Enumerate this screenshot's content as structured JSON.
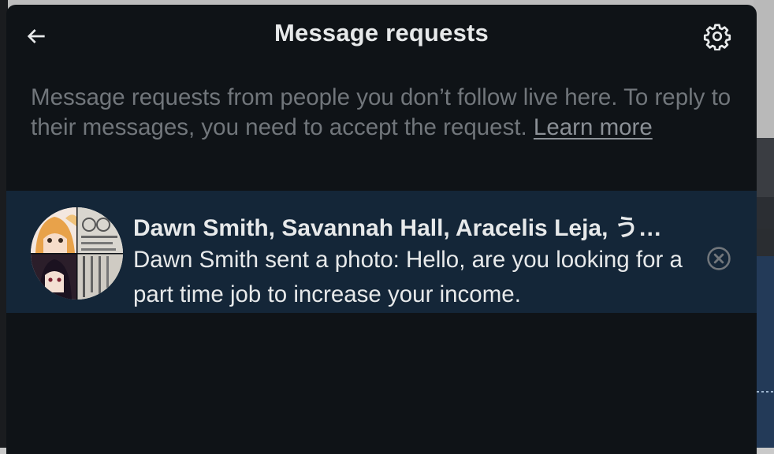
{
  "header": {
    "title": "Message requests",
    "back_icon": "arrow-left-icon",
    "settings_icon": "gear-icon"
  },
  "intro": {
    "text": "Message requests from people you don’t follow live here. To reply to their messages, you need to accept the request. ",
    "link": "Learn more"
  },
  "requests": [
    {
      "participants": "Dawn Smith, Savannah Hall, Aracelis Leja, う…",
      "preview": "Dawn Smith sent a photo: Hello, are you looking for a part time job to increase your income.",
      "dismiss_icon": "close-circle-icon"
    }
  ],
  "colors": {
    "panel_bg": "#0f1317",
    "row_bg": "#142638",
    "primary_text": "#e7e9ea",
    "secondary_text": "#71767b"
  }
}
